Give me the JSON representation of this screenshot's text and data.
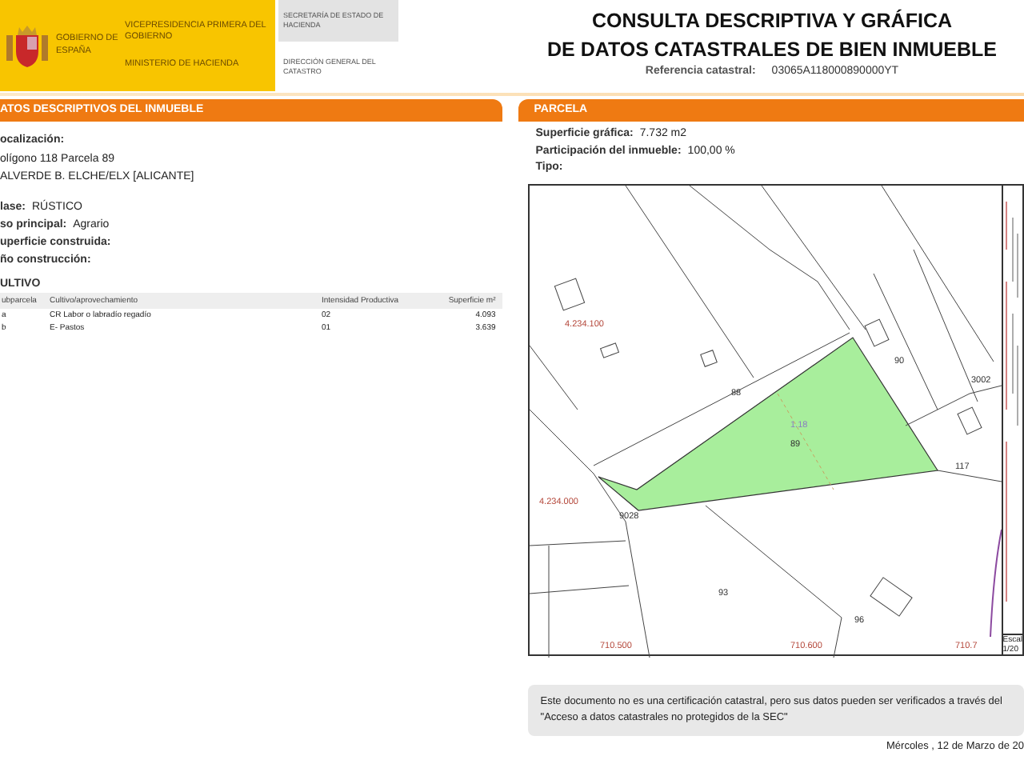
{
  "header": {
    "government": "GOBIERNO DE ESPAÑA",
    "vicepresidency": "VICEPRESIDENCIA PRIMERA DEL GOBIERNO",
    "ministry": "MINISTERIO DE HACIENDA",
    "secretariat": "SECRETARÍA DE ESTADO DE HACIENDA",
    "directorate": "DIRECCIÓN GENERAL DEL CATASTRO",
    "title_lines": [
      "CONSULTA DESCRIPTIVA Y GRÁFICA",
      "DE DATOS CATASTRALES DE BIEN INMUEBLE"
    ],
    "reference_label": "Referencia catastral:",
    "reference_value": "03065A118000890000YT"
  },
  "left_panel": {
    "title": "ATOS DESCRIPTIVOS DEL INMUEBLE",
    "location_label": "ocalización:",
    "location_lines": [
      "olígono 118 Parcela 89",
      "ALVERDE B. ELCHE/ELX [ALICANTE]"
    ],
    "fields": [
      {
        "label": "lase:",
        "value": "RÚSTICO"
      },
      {
        "label": "so principal:",
        "value": "Agrario"
      },
      {
        "label": "uperficie construida:"
      },
      {
        "label": "ño construcción:"
      }
    ],
    "cultivo": {
      "title": "ULTIVO",
      "columns": [
        "ubparcela",
        "Cultivo/aprovechamiento",
        "Intensidad Productiva",
        "Superficie m²"
      ],
      "rows": [
        [
          "a",
          "CR Labor o labradío regadío",
          "02",
          "4.093"
        ],
        [
          "b",
          "E- Pastos",
          "01",
          "3.639"
        ]
      ]
    }
  },
  "right_panel": {
    "title": "PARCELA",
    "fields": [
      {
        "label": "Superficie gráfica:",
        "value": "7.732 m2"
      },
      {
        "label": "Participación del inmueble:",
        "value": "100,00 %"
      },
      {
        "label": "Tipo:"
      }
    ],
    "map": {
      "labels": [
        {
          "text": "4.234.100",
          "kind": "coordinate"
        },
        {
          "text": "88",
          "kind": "parcel"
        },
        {
          "text": "1.18",
          "kind": "subparcel"
        },
        {
          "text": "89",
          "kind": "parcel"
        },
        {
          "text": "90",
          "kind": "parcel"
        },
        {
          "text": "3002",
          "kind": "parcel"
        },
        {
          "text": "117",
          "kind": "parcel"
        },
        {
          "text": "4.234.000",
          "kind": "coordinate"
        },
        {
          "text": "9028",
          "kind": "parcel"
        },
        {
          "text": "93",
          "kind": "parcel"
        },
        {
          "text": "96",
          "kind": "parcel"
        },
        {
          "text": "710.500",
          "kind": "coordinate"
        },
        {
          "text": "710.600",
          "kind": "coordinate"
        },
        {
          "text": "710.7",
          "kind": "coordinate"
        }
      ],
      "scale_label": "Escal",
      "scale_value": "1/20"
    },
    "note": "Este documento no es una certificación catastral, pero sus datos pueden ser verificados a través del \"Acceso a datos catastrales no protegidos de la SEC\"",
    "date": "Mércoles , 12 de Marzo de 20"
  }
}
